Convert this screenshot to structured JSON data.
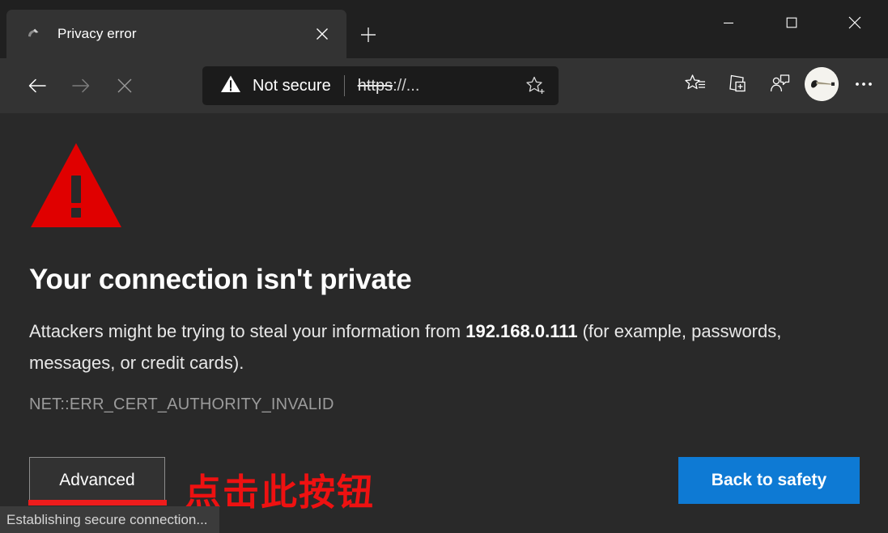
{
  "window": {
    "controls": [
      {
        "name": "minimize",
        "glyph": "minimize-icon"
      },
      {
        "name": "maximize",
        "glyph": "maximize-icon"
      },
      {
        "name": "close",
        "glyph": "close-icon"
      }
    ]
  },
  "tabs": [
    {
      "title": "Privacy error",
      "favicon": "broken-page-icon",
      "close_label": "×",
      "active": true
    }
  ],
  "newtab": {
    "label": "+",
    "tooltip": "New tab"
  },
  "toolbar": {
    "back": "back-arrow-icon",
    "forward": "forward-arrow-icon",
    "stop": "stop-x-icon",
    "security_label": "Not secure",
    "security_icon": "warning-triangle-icon",
    "url_scheme": "https",
    "url_rest": "://...",
    "url_full": "https://...",
    "favorite_icon": "star-plus-icon",
    "right_icons": [
      {
        "name": "favorites-icon",
        "label": "Favorites"
      },
      {
        "name": "collections-icon",
        "label": "Collections"
      },
      {
        "name": "profile-share-icon",
        "label": "Profile"
      },
      {
        "name": "avatar",
        "label": "Account avatar"
      },
      {
        "name": "settings-more-icon",
        "label": "Settings and more"
      }
    ]
  },
  "page": {
    "icon": "red-warning-triangle",
    "headline": "Your connection isn't private",
    "body_before": "Attackers might be trying to steal your information from ",
    "body_host": "192.168.0.111",
    "body_after": " (for example, passwords, messages, or credit cards).",
    "error_code": "NET::ERR_CERT_AUTHORITY_INVALID",
    "advanced_label": "Advanced",
    "back_to_safety_label": "Back to safety"
  },
  "annotation": {
    "text": "点击此按钮",
    "color": "#ee1111",
    "underline_color": "#ee1c1c"
  },
  "statusbar": {
    "text": "Establishing secure connection..."
  },
  "colors": {
    "titlebar_bg": "#202020",
    "toolbar_bg": "#333333",
    "tab_bg": "#333333",
    "omnibox_bg": "#1b1b1b",
    "page_bg": "#292929",
    "statusbar_bg": "#3b3b3b",
    "accent_blue": "#0e7ad4",
    "warning_red": "#e00000",
    "annotation_red": "#ee1111"
  }
}
